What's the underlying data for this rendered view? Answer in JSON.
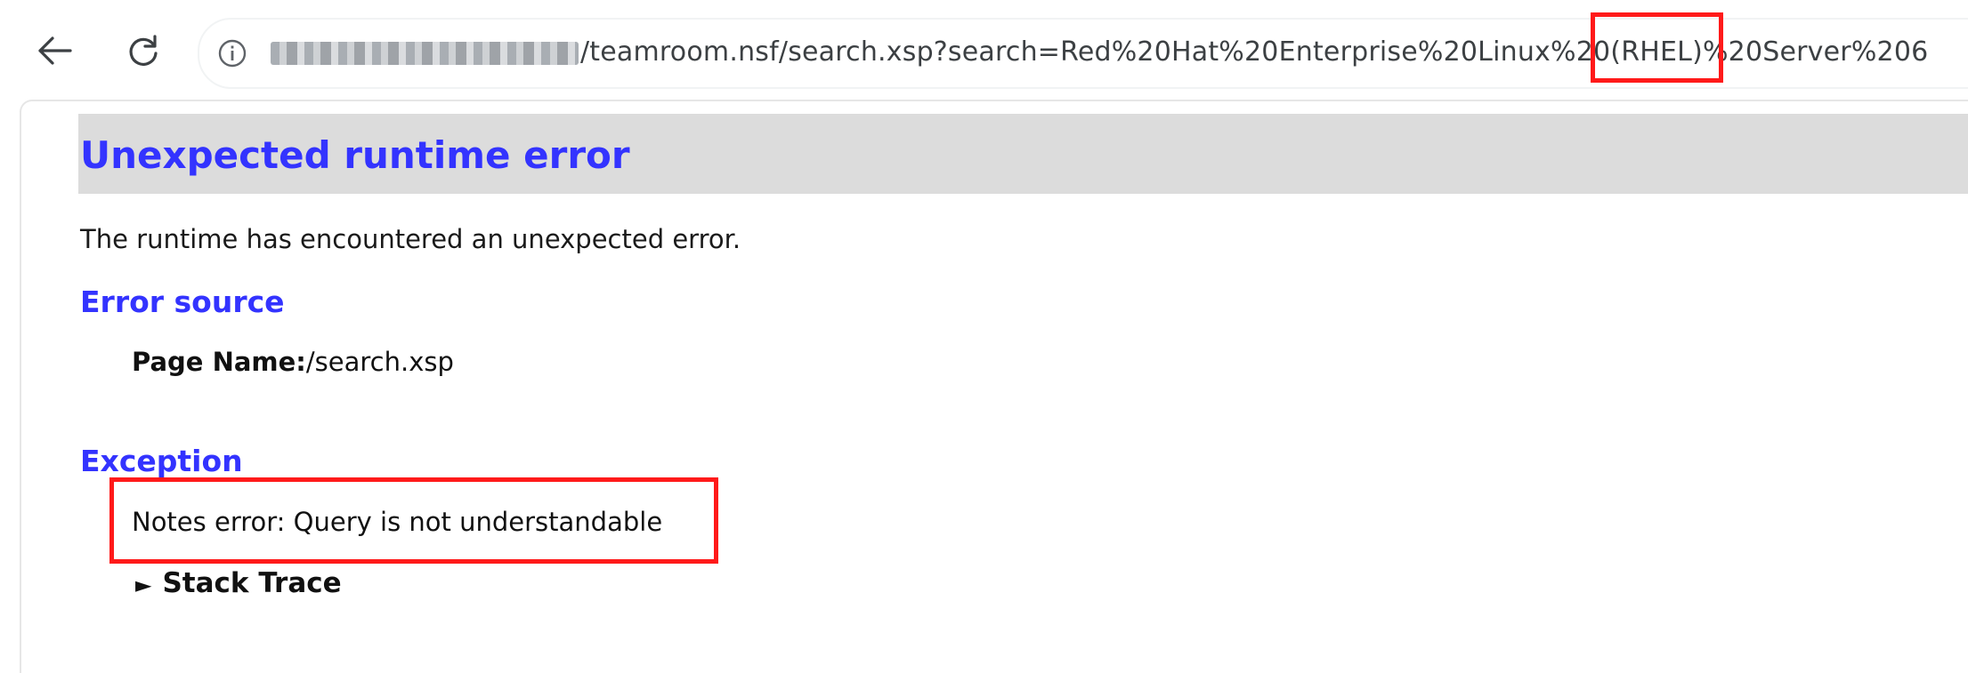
{
  "browser": {
    "url_path": "/teamroom.nsf/search.xsp?search=Red%20Hat%20Enterprise%20Linux%20(RHEL)%20Server%206",
    "back_icon": "arrow-left-icon",
    "reload_icon": "reload-icon",
    "info_icon": "info-circle-icon"
  },
  "error_page": {
    "title": "Unexpected runtime error",
    "intro": "The runtime has encountered an unexpected error.",
    "source_heading": "Error source",
    "page_name_label": "Page Name:",
    "page_name_value": "/search.xsp",
    "exception_heading": "Exception",
    "exception_message": "Notes error: Query is not understandable",
    "stack_trace_label": "Stack Trace",
    "stack_trace_marker": "►"
  },
  "colors": {
    "heading": "#3333ff",
    "title_bar": "#dcdcdc",
    "annotation": "#ff1a1a"
  }
}
